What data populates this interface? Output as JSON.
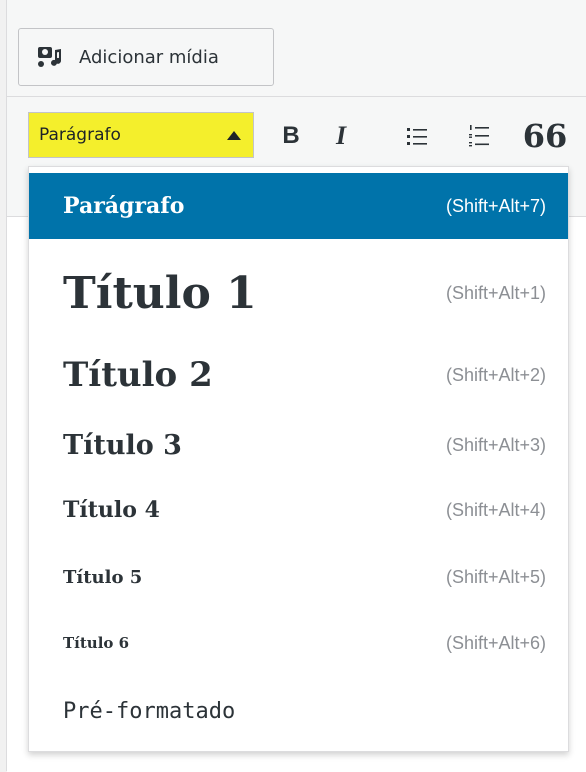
{
  "toolbar": {
    "media_button_label": "Adicionar mídia",
    "format_select_value": "Parágrafo",
    "bold_label": "B",
    "italic_label": "I",
    "quote_label": "66"
  },
  "format_menu": {
    "items": [
      {
        "label": "Parágrafo",
        "shortcut": "(Shift+Alt+7)"
      },
      {
        "label": "Título 1",
        "shortcut": "(Shift+Alt+1)"
      },
      {
        "label": "Título 2",
        "shortcut": "(Shift+Alt+2)"
      },
      {
        "label": "Título 3",
        "shortcut": "(Shift+Alt+3)"
      },
      {
        "label": "Título 4",
        "shortcut": "(Shift+Alt+4)"
      },
      {
        "label": "Título 5",
        "shortcut": "(Shift+Alt+5)"
      },
      {
        "label": "Título 6",
        "shortcut": "(Shift+Alt+6)"
      },
      {
        "label": "Pré-formatado",
        "shortcut": ""
      }
    ]
  },
  "colors": {
    "active_item_bg": "#0073aa",
    "select_highlight": "#f4ef2c"
  }
}
